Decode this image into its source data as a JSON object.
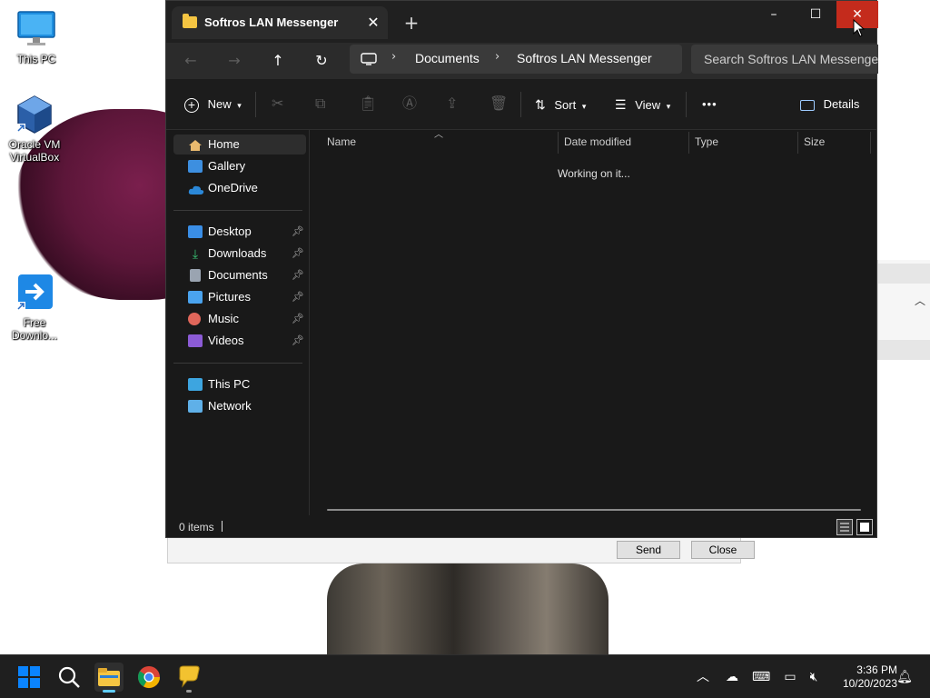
{
  "desktop": {
    "icons": [
      {
        "label": "This PC",
        "icon": "monitor-icon"
      },
      {
        "label": "Oracle VM VirtualBox",
        "icon": "virtualbox-icon"
      },
      {
        "label": "Free Downlo...",
        "icon": "download-manager-icon"
      }
    ],
    "behind_window": {
      "send_label": "Send",
      "close_label": "Close"
    }
  },
  "explorer": {
    "tab_title": "Softros LAN Messenger",
    "window_controls": {
      "minimize": "–",
      "maximize": "☐",
      "close": "✕"
    },
    "breadcrumbs": [
      "Documents",
      "Softros LAN Messenger"
    ],
    "search_placeholder": "Search Softros LAN Messenger",
    "toolbar": {
      "new_label": "New",
      "sort_label": "Sort",
      "view_label": "View",
      "more_label": "•••",
      "details_label": "Details"
    },
    "sidebar": {
      "top": [
        {
          "label": "Home",
          "icon": "home-icon",
          "active": true
        },
        {
          "label": "Gallery",
          "icon": "gallery-icon"
        },
        {
          "label": "OneDrive",
          "icon": "cloud-icon"
        }
      ],
      "quick": [
        {
          "label": "Desktop",
          "icon": "desktop-folder-icon",
          "pinned": true
        },
        {
          "label": "Downloads",
          "icon": "download-icon",
          "pinned": true
        },
        {
          "label": "Documents",
          "icon": "document-icon",
          "pinned": true
        },
        {
          "label": "Pictures",
          "icon": "pictures-icon",
          "pinned": true
        },
        {
          "label": "Music",
          "icon": "music-icon",
          "pinned": true
        },
        {
          "label": "Videos",
          "icon": "video-icon",
          "pinned": true
        }
      ],
      "bottom": [
        {
          "label": "This PC",
          "icon": "computer-icon"
        },
        {
          "label": "Network",
          "icon": "network-icon"
        }
      ]
    },
    "columns": [
      "Name",
      "Date modified",
      "Type",
      "Size"
    ],
    "loading_text": "Working on it...",
    "status_text": "0 items"
  },
  "taskbar": {
    "time": "3:36 PM",
    "date": "10/20/2023"
  },
  "colors": {
    "close_red": "#c42b1c",
    "folder_yellow": "#f5c542",
    "windows_blue": "#0a84ff"
  }
}
